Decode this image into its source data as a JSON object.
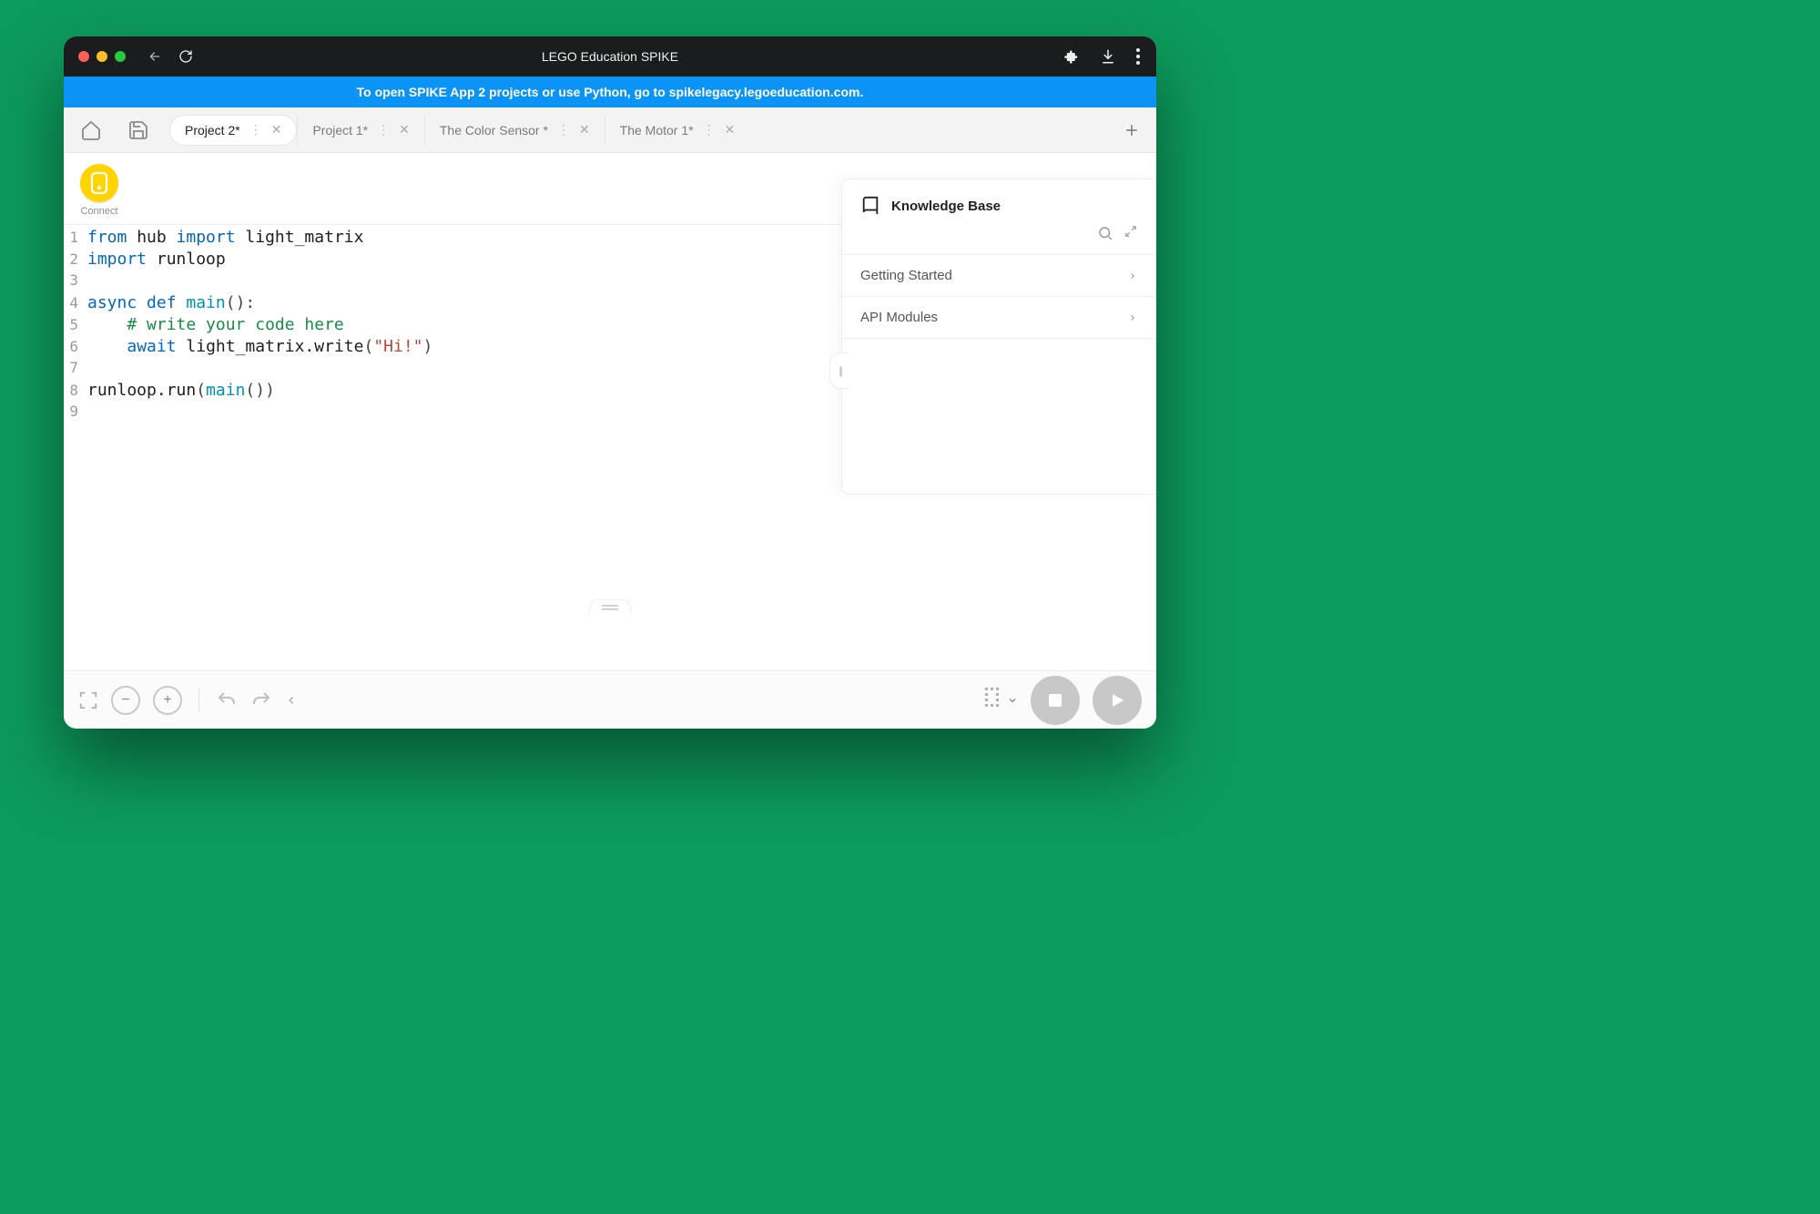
{
  "window_title": "LEGO Education SPIKE",
  "banner": "To open SPIKE App 2 projects or use Python, go to spikelegacy.legoeducation.com.",
  "tabs": [
    {
      "label": "Project 2*",
      "active": true
    },
    {
      "label": "Project 1*",
      "active": false
    },
    {
      "label": "The Color Sensor *",
      "active": false
    },
    {
      "label": "The Motor 1*",
      "active": false
    }
  ],
  "connect_label": "Connect",
  "code_lines": [
    "from hub import light_matrix",
    "import runloop",
    "",
    "async def main():",
    "    # write your code here",
    "    await light_matrix.write(\"Hi!\")",
    "",
    "runloop.run(main())",
    ""
  ],
  "code_tokens": [
    [
      {
        "t": "from ",
        "c": "kw"
      },
      {
        "t": "hub ",
        "c": "id"
      },
      {
        "t": "import ",
        "c": "kw"
      },
      {
        "t": "light_matrix",
        "c": "id"
      }
    ],
    [
      {
        "t": "import ",
        "c": "kw"
      },
      {
        "t": "runloop",
        "c": "id"
      }
    ],
    [],
    [
      {
        "t": "async def ",
        "c": "kw"
      },
      {
        "t": "main",
        "c": "fn"
      },
      {
        "t": "()",
        "c": "pn"
      },
      {
        "t": ":",
        "c": "pn"
      }
    ],
    [
      {
        "t": "    # write your code here",
        "c": "cm"
      }
    ],
    [
      {
        "t": "    ",
        "c": "id"
      },
      {
        "t": "await ",
        "c": "kw"
      },
      {
        "t": "light_matrix.write",
        "c": "id"
      },
      {
        "t": "(",
        "c": "pn"
      },
      {
        "t": "\"Hi!\"",
        "c": "str"
      },
      {
        "t": ")",
        "c": "pn"
      }
    ],
    [],
    [
      {
        "t": "runloop.run",
        "c": "id"
      },
      {
        "t": "(",
        "c": "pn"
      },
      {
        "t": "main",
        "c": "fn"
      },
      {
        "t": "()",
        "c": "pn"
      },
      {
        "t": ")",
        "c": "pn"
      }
    ],
    []
  ],
  "kb": {
    "title": "Knowledge Base",
    "items": [
      "Getting Started",
      "API Modules"
    ]
  }
}
